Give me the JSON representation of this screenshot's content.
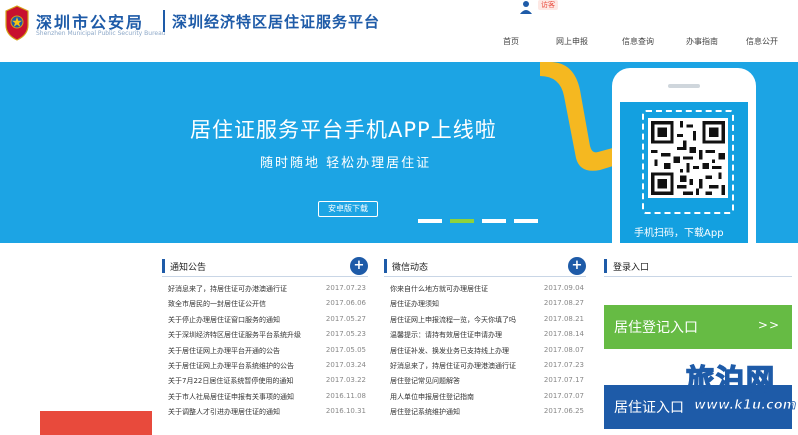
{
  "header": {
    "org_cn": "深圳市公安局",
    "org_en": "Shenzhen Municipal Public Security Bureau",
    "site_title": "深圳经济特区居住证服务平台",
    "user_label": "访客"
  },
  "nav": [
    "首页",
    "网上申报",
    "信息查询",
    "办事指南",
    "信息公开"
  ],
  "banner": {
    "title": "居住证服务平台手机APP上线啦",
    "subtitle": "随时随地  轻松办理居住证",
    "download_label": "安卓版下载",
    "phone_caption": "手机扫码，下载App",
    "slide_count": 4,
    "active_slide": 2
  },
  "notices": {
    "title": "通知公告",
    "items": [
      {
        "title": "好消息来了，持居住证可办港澳通行证",
        "date": "2017.07.23"
      },
      {
        "title": "致全市居民的一封居住证公开信",
        "date": "2017.06.06"
      },
      {
        "title": "关于停止办理居住证窗口服务的通知",
        "date": "2017.05.27"
      },
      {
        "title": "关于深圳经济特区居住证服务平台系统升级",
        "date": "2017.05.23"
      },
      {
        "title": "关于居住证网上办理平台开通的公告",
        "date": "2017.05.05"
      },
      {
        "title": "关于居住证网上办理平台系统维护的公告",
        "date": "2017.03.24"
      },
      {
        "title": "关于7月22日居住证系统暂停使用的通知",
        "date": "2017.03.22"
      },
      {
        "title": "关于市人社局居住证申报有关事项的通知",
        "date": "2016.11.08"
      },
      {
        "title": "关于调整人才引进办理居住证的通知",
        "date": "2016.10.31"
      }
    ]
  },
  "news": {
    "title": "微信动态",
    "items": [
      {
        "title": "你来自什么地方就可办理居住证",
        "date": "2017.09.04"
      },
      {
        "title": "居住证办理须知",
        "date": "2017.08.27"
      },
      {
        "title": "居住证网上申报流程一览，今天你填了吗",
        "date": "2017.08.21"
      },
      {
        "title": "温馨提示：请持有效居住证申请办理",
        "date": "2017.08.14"
      },
      {
        "title": "居住证补发、换发业务已支持线上办理",
        "date": "2017.08.07"
      },
      {
        "title": "好消息来了，持居住证可办理港澳通行证",
        "date": "2017.07.23"
      },
      {
        "title": "居住登记常见问题解答",
        "date": "2017.07.17"
      },
      {
        "title": "用人单位申报居住登记指南",
        "date": "2017.07.07"
      },
      {
        "title": "居住登记系统维护通知",
        "date": "2017.06.25"
      }
    ]
  },
  "login": {
    "title": "登录入口",
    "resident_label": "居住登记入口",
    "resident_arrow": ">>",
    "permit_label": "居住证入口",
    "permit_arrow": ">>"
  },
  "watermark": {
    "cn": "旅泊网",
    "url": "www.k1u.com"
  },
  "colors": {
    "brand_blue": "#1e5ba8",
    "banner_blue": "#1ca4e4",
    "green": "#66bb44",
    "red": "#e84a3c"
  }
}
